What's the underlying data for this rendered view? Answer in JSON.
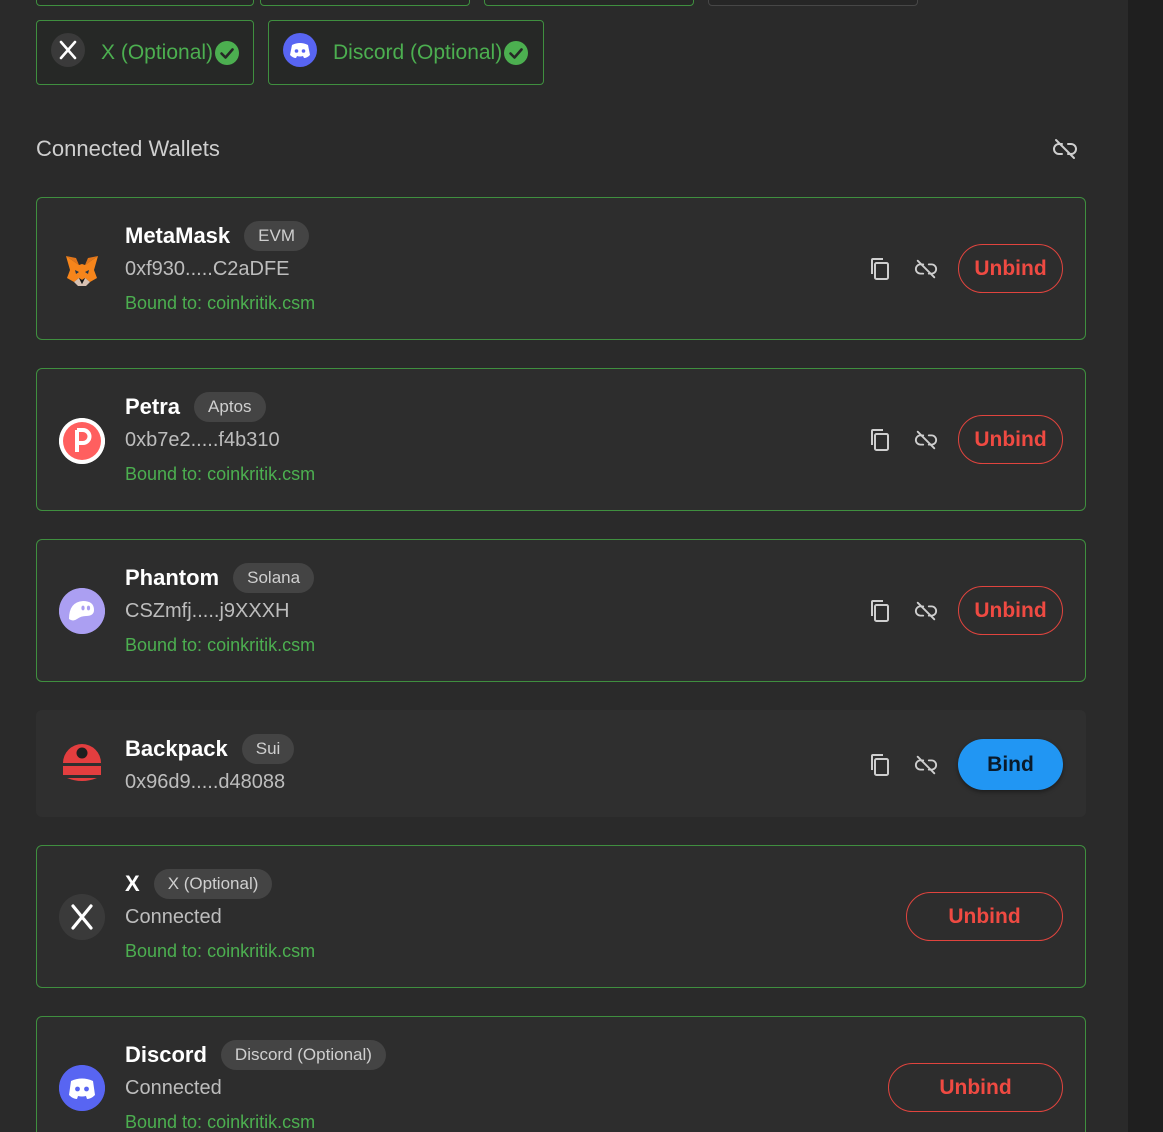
{
  "social_accounts": [
    {
      "label": "X (Optional)",
      "icon": "x-logo-icon",
      "verified": true
    },
    {
      "label": "Discord (Optional)",
      "icon": "discord-logo-icon",
      "verified": true
    }
  ],
  "section": {
    "title": "Connected Wallets"
  },
  "wallets": [
    {
      "name": "MetaMask",
      "chain": "EVM",
      "address": "0xf930.....C2aDFE",
      "bound": "Bound to: coinkritik.csm",
      "action": "Unbind"
    },
    {
      "name": "Petra",
      "chain": "Aptos",
      "address": "0xb7e2.....f4b310",
      "bound": "Bound to: coinkritik.csm",
      "action": "Unbind"
    },
    {
      "name": "Phantom",
      "chain": "Solana",
      "address": "CSZmfj.....j9XXXH",
      "bound": "Bound to: coinkritik.csm",
      "action": "Unbind"
    },
    {
      "name": "Backpack",
      "chain": "Sui",
      "address": "0x96d9.....d48088",
      "bound": "",
      "action": "Bind"
    },
    {
      "name": "X",
      "chain": "X (Optional)",
      "address": "Connected",
      "bound": "Bound to: coinkritik.csm",
      "action": "Unbind"
    },
    {
      "name": "Discord",
      "chain": "Discord (Optional)",
      "address": "Connected",
      "bound": "Bound to: coinkritik.csm",
      "action": "Unbind"
    }
  ],
  "colors": {
    "background": "#2a2a2a",
    "card_border": "#3f8f3f",
    "success_green": "#4caf50",
    "danger_red": "#ef4a42",
    "primary_blue": "#2196f3"
  }
}
